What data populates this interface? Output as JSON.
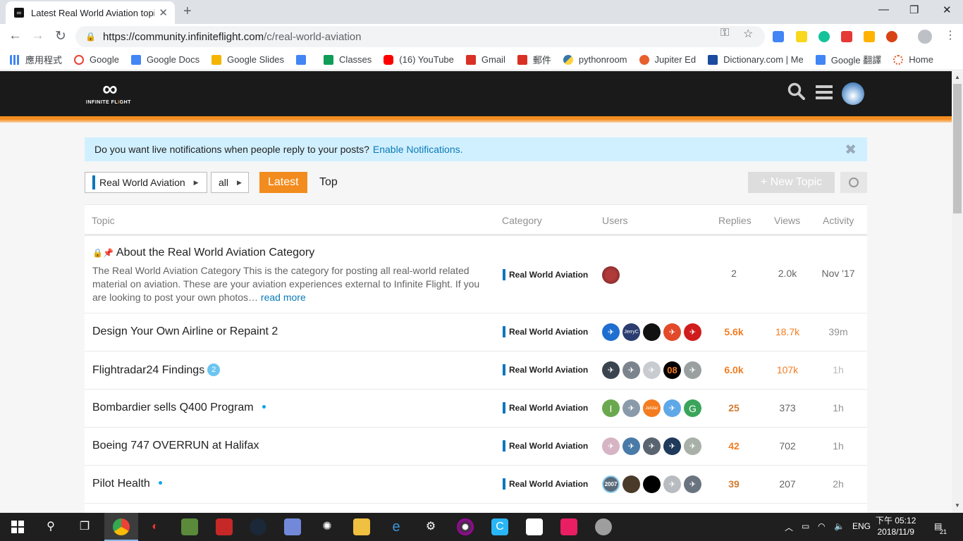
{
  "browser": {
    "tab_title": "Latest Real World Aviation topi",
    "tab_close": "✕",
    "new_tab": "+",
    "url_host": "https://community.infiniteflight.com",
    "url_path": "/c/real-world-aviation",
    "window_controls": [
      "—",
      "❐",
      "✕"
    ]
  },
  "bookmarks": [
    {
      "label": "應用程式",
      "color": "#4285f4"
    },
    {
      "label": "Google",
      "color": "#ea4335"
    },
    {
      "label": "Google Docs",
      "color": "#4285f4"
    },
    {
      "label": "Google Slides",
      "color": "#f4b400"
    },
    {
      "label": "",
      "color": "#4285f4"
    },
    {
      "label": "Classes",
      "color": "#0f9d58"
    },
    {
      "label": "(16) YouTube",
      "color": "#ff0000"
    },
    {
      "label": "Gmail",
      "color": "#d93025"
    },
    {
      "label": "郵件",
      "color": "#d93025"
    },
    {
      "label": "pythonroom",
      "color": "#3776ab"
    },
    {
      "label": "Jupiter Ed",
      "color": "#e8602c"
    },
    {
      "label": "Dictionary.com | Me",
      "color": "#1a4b9c"
    },
    {
      "label": "Google 翻譯",
      "color": "#4285f4"
    },
    {
      "label": "Home",
      "color": "#e8602c"
    }
  ],
  "site": {
    "logo_word_1": "INFINITE FL",
    "logo_word_o": "I",
    "logo_word_2": "GHT",
    "logo_mark": "∞"
  },
  "notice": {
    "text": "Do you want live notifications when people reply to your posts?",
    "link": "Enable Notifications.",
    "close": "✖"
  },
  "nav": {
    "category": "Real World Aviation",
    "filter": "all",
    "latest": "Latest",
    "top": "Top",
    "new_topic": "+  New Topic"
  },
  "columns": {
    "topic": "Topic",
    "category": "Category",
    "users": "Users",
    "replies": "Replies",
    "views": "Views",
    "activity": "Activity"
  },
  "topics": [
    {
      "title": "About the Real World Aviation Category",
      "excerpt": "The Real World Aviation Category This is the category for posting all real-world related material on aviation. These are your aviation experiences external to Infinite Flight. If you are looking to post your own photos…",
      "read_more": "read more",
      "category": "Real World Aviation",
      "replies": "2",
      "views": "2.0k",
      "activity": "Nov '17"
    },
    {
      "title": "Design Your Own Airline or Repaint 2",
      "category": "Real World Aviation",
      "replies": "5.6k",
      "views": "18.7k",
      "activity": "39m"
    },
    {
      "title": "Flightradar24 Findings",
      "badge": "2",
      "category": "Real World Aviation",
      "replies": "6.0k",
      "views": "107k",
      "activity": "1h"
    },
    {
      "title": "Bombardier sells Q400 Program",
      "category": "Real World Aviation",
      "replies": "25",
      "views": "373",
      "activity": "1h"
    },
    {
      "title": "Boeing 747 OVERRUN at Halifax",
      "category": "Real World Aviation",
      "replies": "42",
      "views": "702",
      "activity": "1h"
    },
    {
      "title": "Pilot Health",
      "category": "Real World Aviation",
      "replies": "39",
      "views": "207",
      "activity": "2h"
    }
  ],
  "avatar_text": {
    "jerryc": "JerryC",
    "o8": "08",
    "i": "I",
    "jetstar": "Jetstar",
    "g": "G",
    "y2007": "2007"
  },
  "taskbar": {
    "lang": "ENG",
    "time": "下午 05:12",
    "date": "2018/11/9",
    "notif_count": "21"
  },
  "colors": {
    "accent": "#f28c1f",
    "header": "#1a1a1a",
    "category_bar": "#0e76bd",
    "link": "#0a7ab8",
    "hot": "#f47c20",
    "warm": "#d27a2e",
    "muted": "#919191"
  }
}
